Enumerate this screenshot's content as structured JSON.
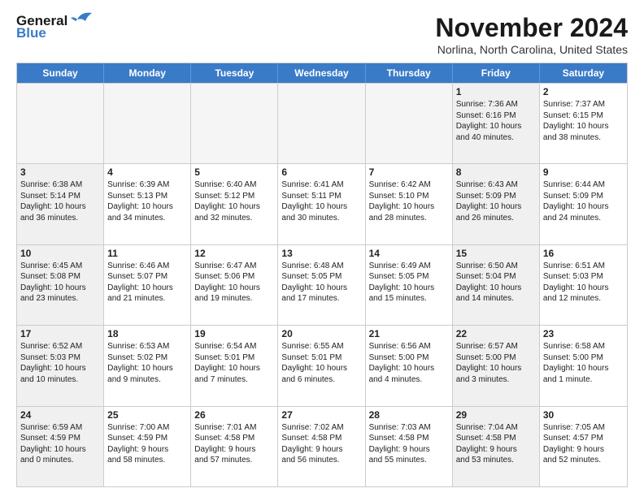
{
  "header": {
    "logo_line1": "General",
    "logo_line2": "Blue",
    "month": "November 2024",
    "location": "Norlina, North Carolina, United States"
  },
  "weekdays": [
    "Sunday",
    "Monday",
    "Tuesday",
    "Wednesday",
    "Thursday",
    "Friday",
    "Saturday"
  ],
  "weeks": [
    [
      {
        "day": "",
        "info": "",
        "empty": true
      },
      {
        "day": "",
        "info": "",
        "empty": true
      },
      {
        "day": "",
        "info": "",
        "empty": true
      },
      {
        "day": "",
        "info": "",
        "empty": true
      },
      {
        "day": "",
        "info": "",
        "empty": true
      },
      {
        "day": "1",
        "info": "Sunrise: 7:36 AM\nSunset: 6:16 PM\nDaylight: 10 hours\nand 40 minutes.",
        "shaded": true
      },
      {
        "day": "2",
        "info": "Sunrise: 7:37 AM\nSunset: 6:15 PM\nDaylight: 10 hours\nand 38 minutes.",
        "shaded": false
      }
    ],
    [
      {
        "day": "3",
        "info": "Sunrise: 6:38 AM\nSunset: 5:14 PM\nDaylight: 10 hours\nand 36 minutes.",
        "shaded": true
      },
      {
        "day": "4",
        "info": "Sunrise: 6:39 AM\nSunset: 5:13 PM\nDaylight: 10 hours\nand 34 minutes.",
        "shaded": false
      },
      {
        "day": "5",
        "info": "Sunrise: 6:40 AM\nSunset: 5:12 PM\nDaylight: 10 hours\nand 32 minutes.",
        "shaded": false
      },
      {
        "day": "6",
        "info": "Sunrise: 6:41 AM\nSunset: 5:11 PM\nDaylight: 10 hours\nand 30 minutes.",
        "shaded": false
      },
      {
        "day": "7",
        "info": "Sunrise: 6:42 AM\nSunset: 5:10 PM\nDaylight: 10 hours\nand 28 minutes.",
        "shaded": false
      },
      {
        "day": "8",
        "info": "Sunrise: 6:43 AM\nSunset: 5:09 PM\nDaylight: 10 hours\nand 26 minutes.",
        "shaded": true
      },
      {
        "day": "9",
        "info": "Sunrise: 6:44 AM\nSunset: 5:09 PM\nDaylight: 10 hours\nand 24 minutes.",
        "shaded": false
      }
    ],
    [
      {
        "day": "10",
        "info": "Sunrise: 6:45 AM\nSunset: 5:08 PM\nDaylight: 10 hours\nand 23 minutes.",
        "shaded": true
      },
      {
        "day": "11",
        "info": "Sunrise: 6:46 AM\nSunset: 5:07 PM\nDaylight: 10 hours\nand 21 minutes.",
        "shaded": false
      },
      {
        "day": "12",
        "info": "Sunrise: 6:47 AM\nSunset: 5:06 PM\nDaylight: 10 hours\nand 19 minutes.",
        "shaded": false
      },
      {
        "day": "13",
        "info": "Sunrise: 6:48 AM\nSunset: 5:05 PM\nDaylight: 10 hours\nand 17 minutes.",
        "shaded": false
      },
      {
        "day": "14",
        "info": "Sunrise: 6:49 AM\nSunset: 5:05 PM\nDaylight: 10 hours\nand 15 minutes.",
        "shaded": false
      },
      {
        "day": "15",
        "info": "Sunrise: 6:50 AM\nSunset: 5:04 PM\nDaylight: 10 hours\nand 14 minutes.",
        "shaded": true
      },
      {
        "day": "16",
        "info": "Sunrise: 6:51 AM\nSunset: 5:03 PM\nDaylight: 10 hours\nand 12 minutes.",
        "shaded": false
      }
    ],
    [
      {
        "day": "17",
        "info": "Sunrise: 6:52 AM\nSunset: 5:03 PM\nDaylight: 10 hours\nand 10 minutes.",
        "shaded": true
      },
      {
        "day": "18",
        "info": "Sunrise: 6:53 AM\nSunset: 5:02 PM\nDaylight: 10 hours\nand 9 minutes.",
        "shaded": false
      },
      {
        "day": "19",
        "info": "Sunrise: 6:54 AM\nSunset: 5:01 PM\nDaylight: 10 hours\nand 7 minutes.",
        "shaded": false
      },
      {
        "day": "20",
        "info": "Sunrise: 6:55 AM\nSunset: 5:01 PM\nDaylight: 10 hours\nand 6 minutes.",
        "shaded": false
      },
      {
        "day": "21",
        "info": "Sunrise: 6:56 AM\nSunset: 5:00 PM\nDaylight: 10 hours\nand 4 minutes.",
        "shaded": false
      },
      {
        "day": "22",
        "info": "Sunrise: 6:57 AM\nSunset: 5:00 PM\nDaylight: 10 hours\nand 3 minutes.",
        "shaded": true
      },
      {
        "day": "23",
        "info": "Sunrise: 6:58 AM\nSunset: 5:00 PM\nDaylight: 10 hours\nand 1 minute.",
        "shaded": false
      }
    ],
    [
      {
        "day": "24",
        "info": "Sunrise: 6:59 AM\nSunset: 4:59 PM\nDaylight: 10 hours\nand 0 minutes.",
        "shaded": true
      },
      {
        "day": "25",
        "info": "Sunrise: 7:00 AM\nSunset: 4:59 PM\nDaylight: 9 hours\nand 58 minutes.",
        "shaded": false
      },
      {
        "day": "26",
        "info": "Sunrise: 7:01 AM\nSunset: 4:58 PM\nDaylight: 9 hours\nand 57 minutes.",
        "shaded": false
      },
      {
        "day": "27",
        "info": "Sunrise: 7:02 AM\nSunset: 4:58 PM\nDaylight: 9 hours\nand 56 minutes.",
        "shaded": false
      },
      {
        "day": "28",
        "info": "Sunrise: 7:03 AM\nSunset: 4:58 PM\nDaylight: 9 hours\nand 55 minutes.",
        "shaded": false
      },
      {
        "day": "29",
        "info": "Sunrise: 7:04 AM\nSunset: 4:58 PM\nDaylight: 9 hours\nand 53 minutes.",
        "shaded": true
      },
      {
        "day": "30",
        "info": "Sunrise: 7:05 AM\nSunset: 4:57 PM\nDaylight: 9 hours\nand 52 minutes.",
        "shaded": false
      }
    ]
  ]
}
